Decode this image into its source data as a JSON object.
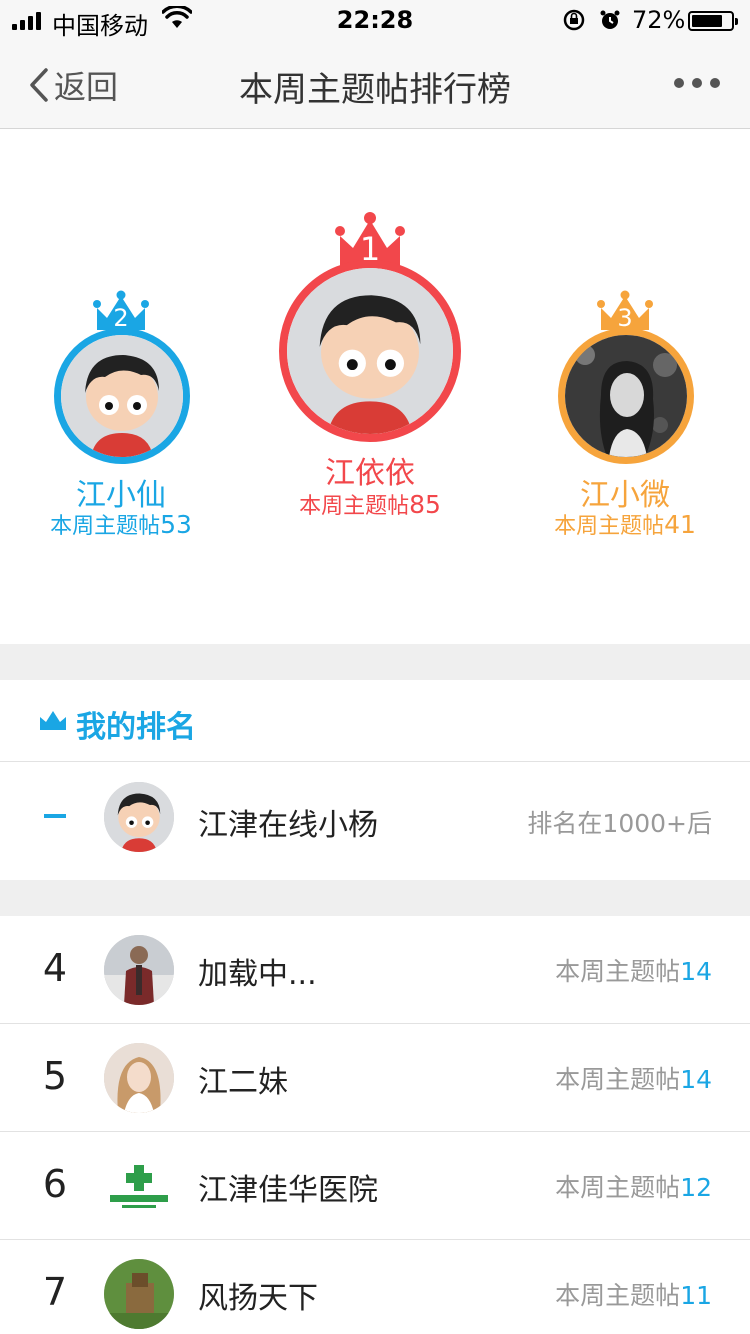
{
  "status": {
    "carrier": "中国移动",
    "time": "22:28",
    "battery": "72%"
  },
  "nav": {
    "back_label": "返回",
    "title": "本周主题帖排行榜"
  },
  "podium": {
    "first": {
      "rank": "1",
      "name": "江依依",
      "count_label": "本周主题帖",
      "count": "85"
    },
    "second": {
      "rank": "2",
      "name": "江小仙",
      "count_label": "本周主题帖",
      "count": "53"
    },
    "third": {
      "rank": "3",
      "name": "江小微",
      "count_label": "本周主题帖",
      "count": "41"
    }
  },
  "my_rank": {
    "title": "我的排名",
    "rank": "–",
    "name": "江津在线小杨",
    "status": "排名在1000+后"
  },
  "rankings": [
    {
      "rank": "4",
      "name": "加载中...",
      "label": "本周主题帖",
      "count": "14"
    },
    {
      "rank": "5",
      "name": "江二妹",
      "label": "本周主题帖",
      "count": "14"
    },
    {
      "rank": "6",
      "name": "江津佳华医院",
      "label": "本周主题帖",
      "count": "12"
    },
    {
      "rank": "7",
      "name": "风扬天下",
      "label": "本周主题帖",
      "count": "11"
    }
  ],
  "colors": {
    "first": "#f2474b",
    "second": "#1aa6e4",
    "third": "#f6a43c",
    "accent": "#1aa6e4"
  }
}
